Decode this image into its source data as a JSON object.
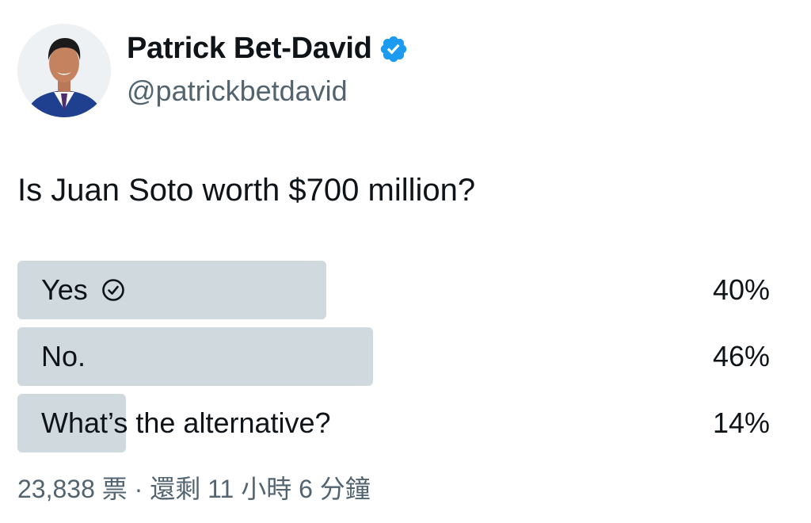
{
  "author": {
    "name": "Patrick Bet-David",
    "handle": "@patrickbetdavid",
    "verified": true,
    "verified_color": "#1d9bf0",
    "avatar_icon": "person-photo"
  },
  "tweet": {
    "text": "Is Juan Soto worth $700 million?"
  },
  "poll": {
    "options": [
      {
        "label": "Yes",
        "percent_label": "40%",
        "percent": 40,
        "selected": true
      },
      {
        "label": "No.",
        "percent_label": "46%",
        "percent": 46,
        "selected": false
      },
      {
        "label": "What’s the alternative?",
        "percent_label": "14%",
        "percent": 14,
        "selected": false
      }
    ],
    "meta": "23,838 票 · 還剩 11 小時 6 分鐘",
    "bar_color": "#cfd9de",
    "check_icon": "check-circle-icon"
  }
}
